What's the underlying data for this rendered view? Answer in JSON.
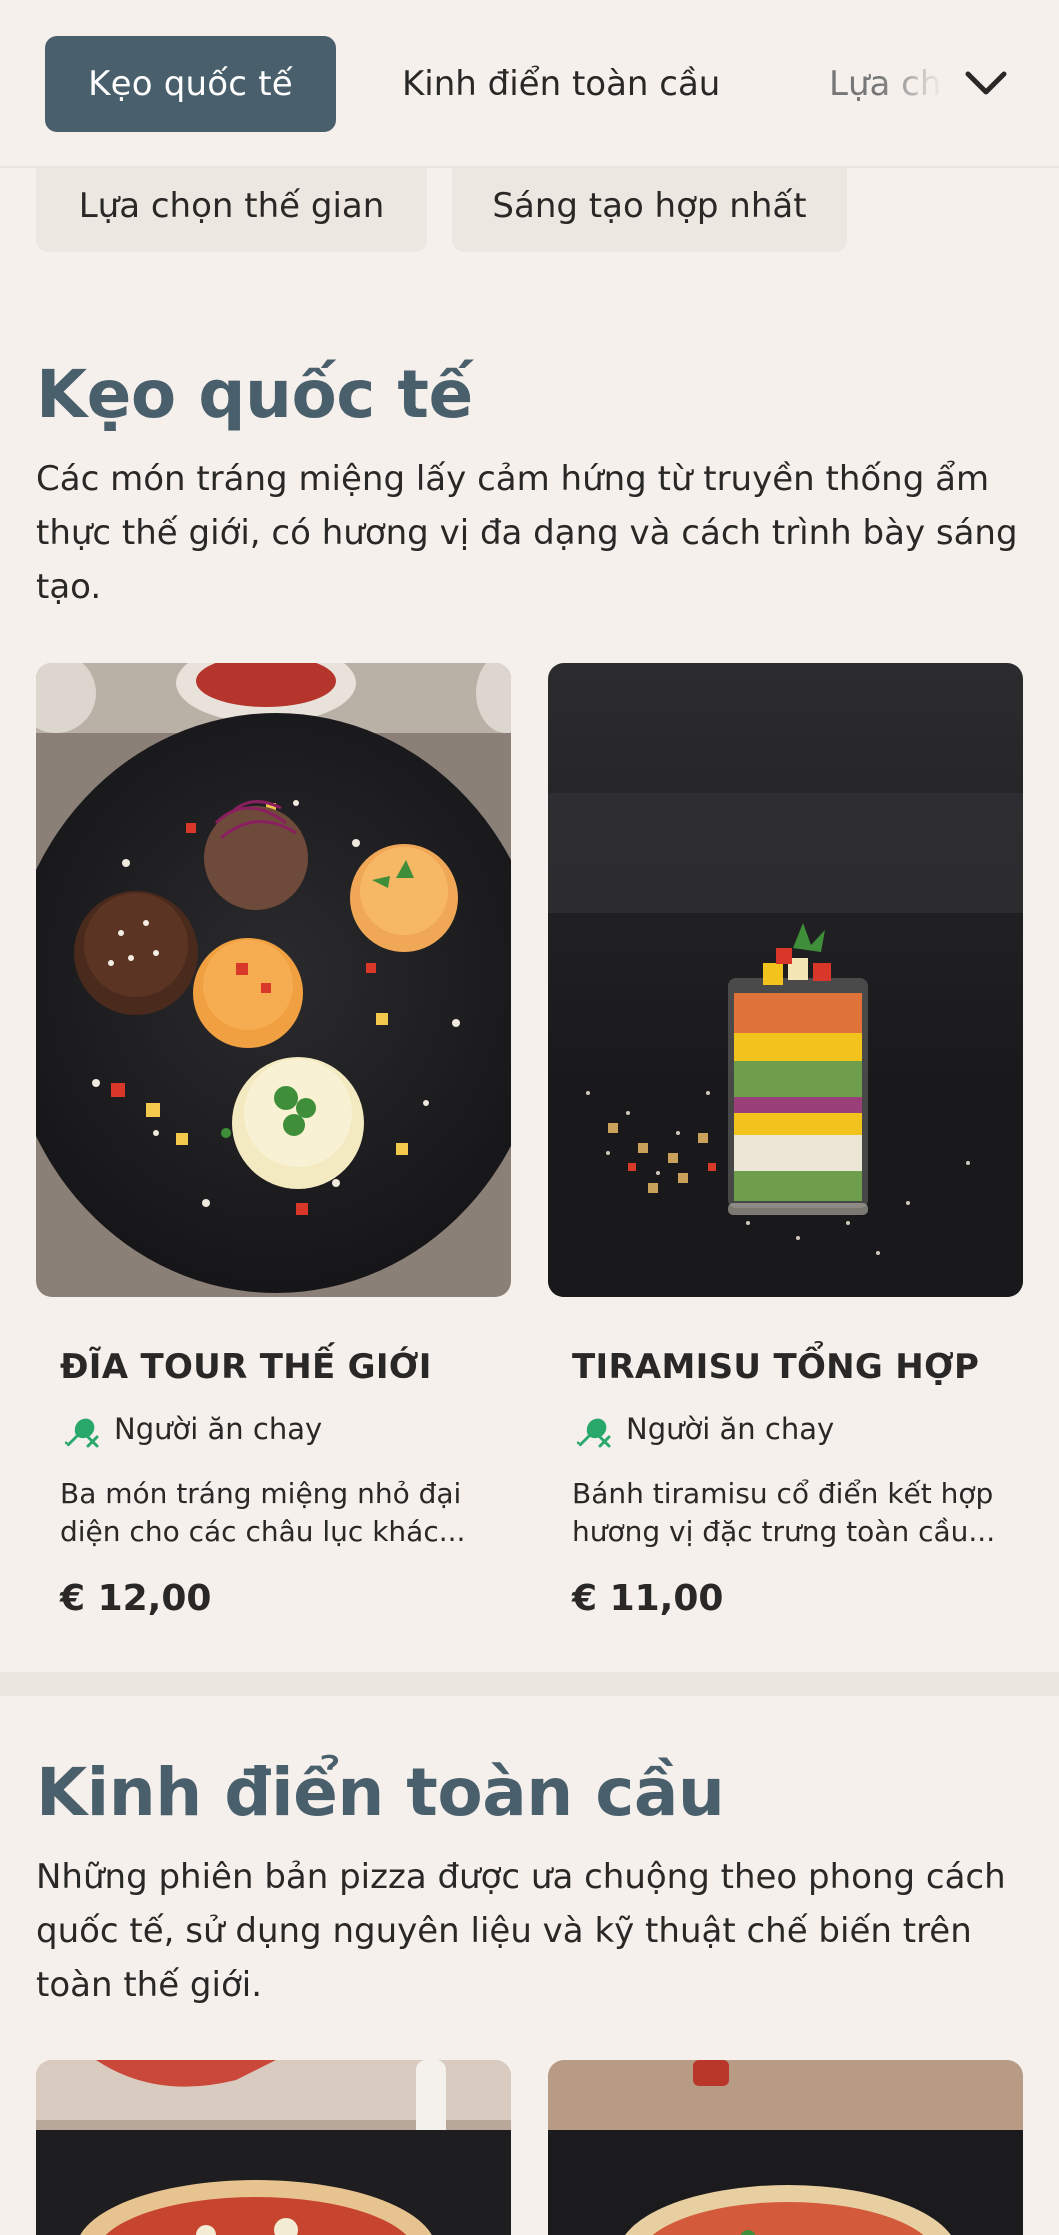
{
  "nav": {
    "tabs": [
      {
        "label": "Kẹo quốc tế",
        "active": true
      },
      {
        "label": "Kinh điển toàn cầu",
        "active": false
      },
      {
        "label": "Lựa chọn thế gian",
        "active": false
      }
    ],
    "more_icon": "chevron-down-icon",
    "chips": [
      "Lựa chọn thế gian",
      "Sáng tạo hợp nhất"
    ]
  },
  "sections": [
    {
      "title": "Kẹo quốc tế",
      "description": "Các món tráng miệng lấy cảm hứng từ truyền thống ẩm thực thế giới, có hương vị đa dạng và cách trình bày sáng tạo.",
      "items": [
        {
          "name": "ĐĨA TOUR THẾ GIỚI",
          "diet": "Người ăn chay",
          "diet_icon": "vegetarian-drumstick-crossed-icon",
          "description": "Ba món tráng miệng nhỏ đại diện cho các châu lục khác...",
          "price": "€ 12,00"
        },
        {
          "name": "TIRAMISU TỔNG HỢP",
          "diet": "Người ăn chay",
          "diet_icon": "vegetarian-drumstick-crossed-icon",
          "description": "Bánh tiramisu cổ điển kết hợp hương vị đặc trưng toàn cầu...",
          "price": "€ 11,00"
        }
      ]
    },
    {
      "title": "Kinh điển toàn cầu",
      "description": "Những phiên bản pizza được ưa chuộng theo phong cách quốc tế, sử dụng nguyên liệu và kỹ thuật chế biến trên toàn thế giới."
    }
  ],
  "colors": {
    "accent": "#4a5f6c",
    "background": "#f5f0ec",
    "diet_green": "#2aa86b"
  }
}
